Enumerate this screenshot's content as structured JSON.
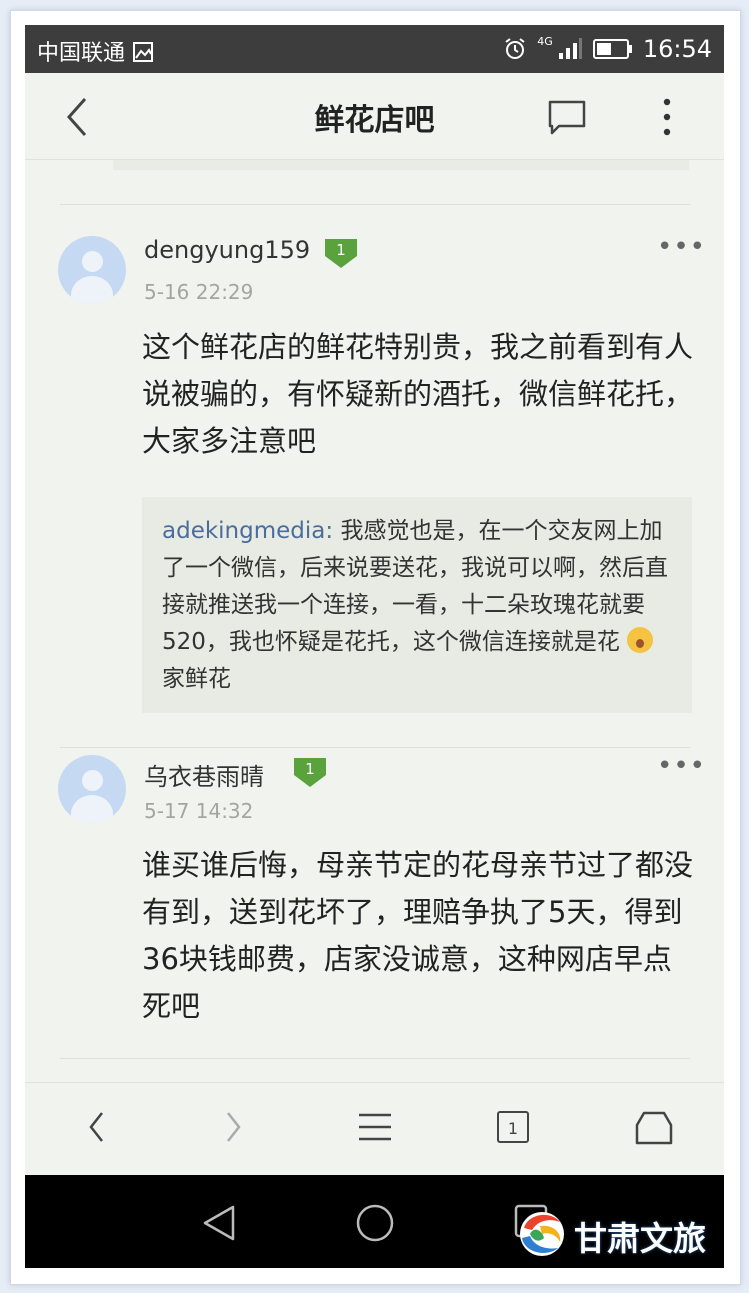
{
  "status_bar": {
    "carrier": "中国联通",
    "network": "4G",
    "time": "16:54"
  },
  "header": {
    "title": "鲜花店吧"
  },
  "posts": [
    {
      "username": "dengyung159",
      "level": "1",
      "date": "5-16 22:29",
      "text": "这个鲜花店的鲜花特别贵，我之前看到有人说被骗的，有怀疑新的酒托，微信鲜花托，大家多注意吧",
      "reply": {
        "user": "adekingmedia:",
        "text_before_emoji": "我感觉也是，在一个交友网上加了一个微信，后来说要送花，我说可以啊，然后直接就推送我一个连接，一看，十二朵玫瑰花就要520，我也怀疑是花托，这个微信连接就是花",
        "text_after_emoji": "家鲜花"
      }
    },
    {
      "username": "乌衣巷雨晴",
      "level": "1",
      "date": "5-17 14:32",
      "text": "谁买谁后悔，母亲节定的花母亲节过了都没有到，送到花坏了，理赔争执了5天，得到36块钱邮费，店家没诚意，这种网店早点死吧"
    }
  ],
  "bottom_bar": {
    "tab_count": "1"
  },
  "watermark": {
    "text": "甘肃文旅"
  },
  "colors": {
    "badge": "#5aa23c",
    "accent_link": "#4a6d9c",
    "background": "#f1f4ee"
  }
}
